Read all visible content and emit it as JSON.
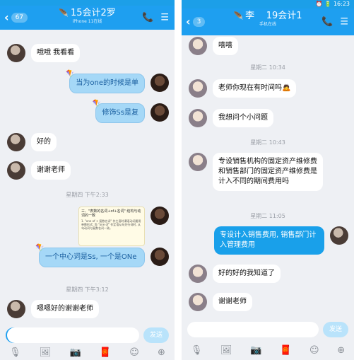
{
  "left": {
    "header": {
      "back_badge": "67",
      "title": "15会计2罗",
      "subtitle": "iPhone 11在线"
    },
    "messages": [
      {
        "text": "哦哦 我看看"
      },
      {
        "text": "当为one的时候是单"
      },
      {
        "text": "修饰Ss是复"
      },
      {
        "text": "好的"
      },
      {
        "text": "谢谢老师"
      },
      {
        "text": "一个中心词是Ss, 一个是ONe"
      },
      {
        "text": "嗯嗯好的谢谢老师"
      }
    ],
    "timestamps": [
      "星期四 下午2:33",
      "星期四 下午3:12"
    ],
    "doc": {
      "title": "三、\"表数的名词+of+名词\" 结构与动词的一致",
      "body": "1. \"one of + 复数名词\" 作主语时谓语动词要用单数形式; 而 \"one of\" 作定语从句先行词时, 从句动词与复数名词一致。"
    },
    "input": {
      "value": "",
      "placeholder": ""
    },
    "send_label": "发送"
  },
  "right": {
    "status": {
      "time": "16:23",
      "icons": "⏰ 🔋"
    },
    "header": {
      "back_badge": "3",
      "title": "19会计1",
      "subtitle": "手机在线",
      "name": "李"
    },
    "messages": [
      {
        "text": "嘻嘻"
      },
      {
        "text": "老师你现在有时间吗🙇"
      },
      {
        "text": "我想问个小问题"
      },
      {
        "text": "专设销售机构的固定资产维修费和销售部门的固定资产维修费是计入不同的期间费用吗"
      },
      {
        "text": "专设计入销售费用, 销售部门计入管理费用"
      },
      {
        "text": "好的好的我知道了"
      },
      {
        "text": "谢谢老师"
      }
    ],
    "timestamps": [
      "星期二 10:34",
      "星期二 10:43",
      "星期二 11:05"
    ],
    "input": {
      "value": "",
      "placeholder": ""
    },
    "send_label": "发送"
  },
  "icons": {
    "back": "chevron-left-icon",
    "phone": "phone-icon",
    "menu": "menu-icon",
    "toolbar": [
      "microphone-icon",
      "image-icon",
      "camera-icon",
      "red-packet-icon",
      "emoji-icon",
      "plus-icon"
    ]
  }
}
